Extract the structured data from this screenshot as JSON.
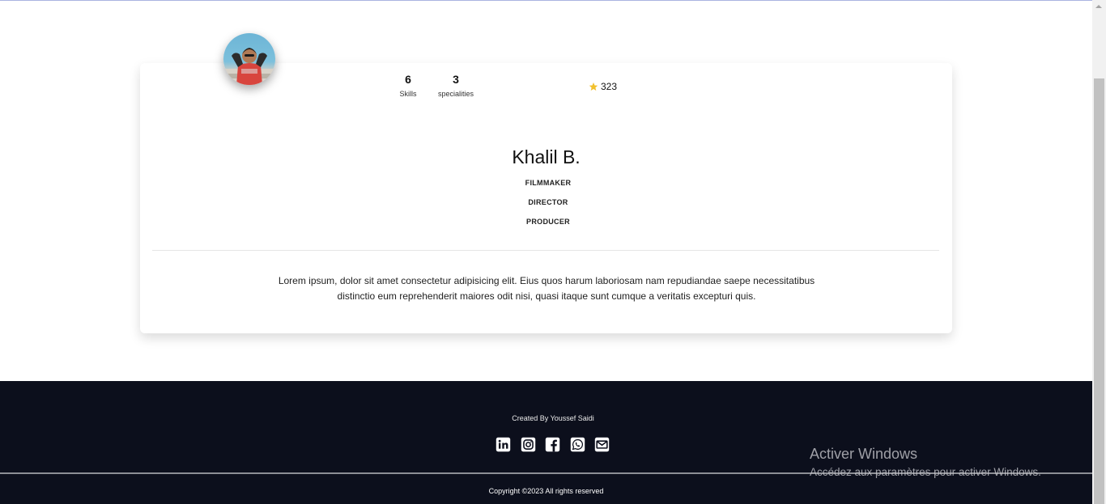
{
  "profile": {
    "name": "Khalil B.",
    "stats": [
      {
        "value": "6",
        "label": "Skills"
      },
      {
        "value": "3",
        "label": "specialities"
      }
    ],
    "rating": "323",
    "roles": [
      "FILMMAKER",
      "DIRECTOR",
      "PRODUCER"
    ],
    "bio": "Lorem ipsum, dolor sit amet consectetur adipisicing elit. Eius quos harum laboriosam nam repudiandae saepe necessitatibus distinctio eum reprehenderit maiores odit nisi, quasi itaque sunt cumque a veritatis excepturi quis."
  },
  "footer": {
    "credit": "Created By Youssef Saidi",
    "socials": [
      "linkedin-icon",
      "instagram-icon",
      "facebook-icon",
      "whatsapp-icon",
      "gmail-icon"
    ],
    "copyright": "Copyright ©2023 All rights reserved"
  },
  "watermark": {
    "title": "Activer Windows",
    "subtitle": "Accédez aux paramètres pour activer Windows."
  },
  "colors": {
    "footer_bg": "#0c0f1c",
    "star": "#f2c12e",
    "card_bg": "#ffffff"
  }
}
